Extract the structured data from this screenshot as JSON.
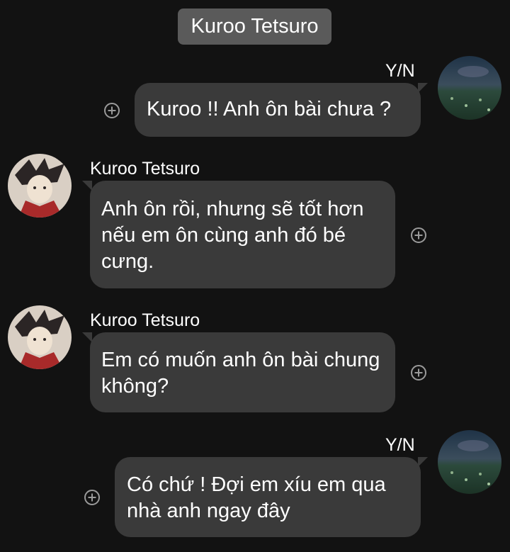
{
  "header": {
    "title": "Kuroo Tetsuro"
  },
  "icons": {
    "add": "plus-circle-icon"
  },
  "messages": [
    {
      "sender": "Y/N",
      "text": "Kuroo !! Anh ôn bài chưa ?"
    },
    {
      "sender": "Kuroo Tetsuro",
      "text": "Anh ôn rồi, nhưng sẽ tốt hơn nếu em ôn cùng anh đó bé cưng."
    },
    {
      "sender": "Kuroo Tetsuro",
      "text": "Em có muốn anh ôn bài chung không?"
    },
    {
      "sender": "Y/N",
      "text": "Có chứ ! Đợi em xíu em qua nhà anh ngay đây"
    }
  ],
  "colors": {
    "background": "#121212",
    "bubble": "#3a3a3a",
    "header_pill": "#5a5a5a"
  }
}
